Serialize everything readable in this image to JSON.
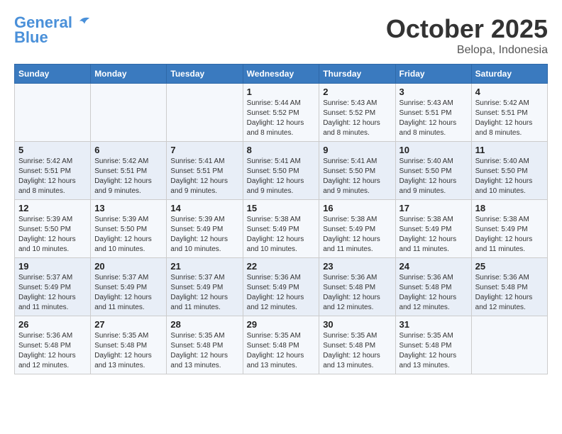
{
  "header": {
    "logo_line1": "General",
    "logo_line2": "Blue",
    "month": "October 2025",
    "location": "Belopa, Indonesia"
  },
  "days_of_week": [
    "Sunday",
    "Monday",
    "Tuesday",
    "Wednesday",
    "Thursday",
    "Friday",
    "Saturday"
  ],
  "weeks": [
    [
      {
        "day": "",
        "info": ""
      },
      {
        "day": "",
        "info": ""
      },
      {
        "day": "",
        "info": ""
      },
      {
        "day": "1",
        "info": "Sunrise: 5:44 AM\nSunset: 5:52 PM\nDaylight: 12 hours and 8 minutes."
      },
      {
        "day": "2",
        "info": "Sunrise: 5:43 AM\nSunset: 5:52 PM\nDaylight: 12 hours and 8 minutes."
      },
      {
        "day": "3",
        "info": "Sunrise: 5:43 AM\nSunset: 5:51 PM\nDaylight: 12 hours and 8 minutes."
      },
      {
        "day": "4",
        "info": "Sunrise: 5:42 AM\nSunset: 5:51 PM\nDaylight: 12 hours and 8 minutes."
      }
    ],
    [
      {
        "day": "5",
        "info": "Sunrise: 5:42 AM\nSunset: 5:51 PM\nDaylight: 12 hours and 8 minutes."
      },
      {
        "day": "6",
        "info": "Sunrise: 5:42 AM\nSunset: 5:51 PM\nDaylight: 12 hours and 9 minutes."
      },
      {
        "day": "7",
        "info": "Sunrise: 5:41 AM\nSunset: 5:51 PM\nDaylight: 12 hours and 9 minutes."
      },
      {
        "day": "8",
        "info": "Sunrise: 5:41 AM\nSunset: 5:50 PM\nDaylight: 12 hours and 9 minutes."
      },
      {
        "day": "9",
        "info": "Sunrise: 5:41 AM\nSunset: 5:50 PM\nDaylight: 12 hours and 9 minutes."
      },
      {
        "day": "10",
        "info": "Sunrise: 5:40 AM\nSunset: 5:50 PM\nDaylight: 12 hours and 9 minutes."
      },
      {
        "day": "11",
        "info": "Sunrise: 5:40 AM\nSunset: 5:50 PM\nDaylight: 12 hours and 10 minutes."
      }
    ],
    [
      {
        "day": "12",
        "info": "Sunrise: 5:39 AM\nSunset: 5:50 PM\nDaylight: 12 hours and 10 minutes."
      },
      {
        "day": "13",
        "info": "Sunrise: 5:39 AM\nSunset: 5:50 PM\nDaylight: 12 hours and 10 minutes."
      },
      {
        "day": "14",
        "info": "Sunrise: 5:39 AM\nSunset: 5:49 PM\nDaylight: 12 hours and 10 minutes."
      },
      {
        "day": "15",
        "info": "Sunrise: 5:38 AM\nSunset: 5:49 PM\nDaylight: 12 hours and 10 minutes."
      },
      {
        "day": "16",
        "info": "Sunrise: 5:38 AM\nSunset: 5:49 PM\nDaylight: 12 hours and 11 minutes."
      },
      {
        "day": "17",
        "info": "Sunrise: 5:38 AM\nSunset: 5:49 PM\nDaylight: 12 hours and 11 minutes."
      },
      {
        "day": "18",
        "info": "Sunrise: 5:38 AM\nSunset: 5:49 PM\nDaylight: 12 hours and 11 minutes."
      }
    ],
    [
      {
        "day": "19",
        "info": "Sunrise: 5:37 AM\nSunset: 5:49 PM\nDaylight: 12 hours and 11 minutes."
      },
      {
        "day": "20",
        "info": "Sunrise: 5:37 AM\nSunset: 5:49 PM\nDaylight: 12 hours and 11 minutes."
      },
      {
        "day": "21",
        "info": "Sunrise: 5:37 AM\nSunset: 5:49 PM\nDaylight: 12 hours and 11 minutes."
      },
      {
        "day": "22",
        "info": "Sunrise: 5:36 AM\nSunset: 5:49 PM\nDaylight: 12 hours and 12 minutes."
      },
      {
        "day": "23",
        "info": "Sunrise: 5:36 AM\nSunset: 5:48 PM\nDaylight: 12 hours and 12 minutes."
      },
      {
        "day": "24",
        "info": "Sunrise: 5:36 AM\nSunset: 5:48 PM\nDaylight: 12 hours and 12 minutes."
      },
      {
        "day": "25",
        "info": "Sunrise: 5:36 AM\nSunset: 5:48 PM\nDaylight: 12 hours and 12 minutes."
      }
    ],
    [
      {
        "day": "26",
        "info": "Sunrise: 5:36 AM\nSunset: 5:48 PM\nDaylight: 12 hours and 12 minutes."
      },
      {
        "day": "27",
        "info": "Sunrise: 5:35 AM\nSunset: 5:48 PM\nDaylight: 12 hours and 13 minutes."
      },
      {
        "day": "28",
        "info": "Sunrise: 5:35 AM\nSunset: 5:48 PM\nDaylight: 12 hours and 13 minutes."
      },
      {
        "day": "29",
        "info": "Sunrise: 5:35 AM\nSunset: 5:48 PM\nDaylight: 12 hours and 13 minutes."
      },
      {
        "day": "30",
        "info": "Sunrise: 5:35 AM\nSunset: 5:48 PM\nDaylight: 12 hours and 13 minutes."
      },
      {
        "day": "31",
        "info": "Sunrise: 5:35 AM\nSunset: 5:48 PM\nDaylight: 12 hours and 13 minutes."
      },
      {
        "day": "",
        "info": ""
      }
    ]
  ]
}
